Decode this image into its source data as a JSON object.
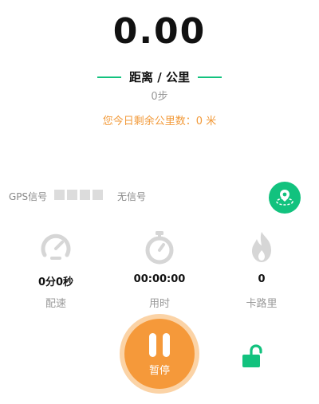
{
  "distance": {
    "value": "0.00",
    "unit_label": "距离 / 公里"
  },
  "steps": "0步",
  "remaining_text": "您今日剩余公里数：0 米",
  "gps": {
    "label": "GPS信号",
    "status": "无信号",
    "bars": 4
  },
  "stats": [
    {
      "value": "0分0秒",
      "label": "配速",
      "icon": "speedometer-icon"
    },
    {
      "value": "00:00:00",
      "label": "用时",
      "icon": "stopwatch-icon"
    },
    {
      "value": "0",
      "label": "卡路里",
      "icon": "flame-icon"
    }
  ],
  "pause_button": {
    "label": "暂停"
  },
  "icons": {
    "map": "map-pin-icon",
    "lock": "unlock-icon"
  },
  "colors": {
    "accent_green": "#12c27e",
    "accent_orange": "#f5993a",
    "muted": "#999999"
  }
}
